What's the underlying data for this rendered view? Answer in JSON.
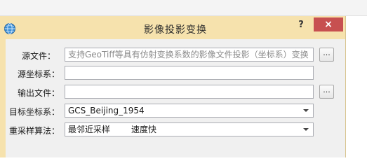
{
  "dialog": {
    "title": "影像投影变换",
    "help_label": "?",
    "close_label": "×"
  },
  "fields": {
    "source_file": {
      "label": "源文件：",
      "value": "",
      "placeholder": "支持GeoTiff等具有仿射变换系数的影像文件投影（坐标系）变换",
      "browse_label": "..."
    },
    "source_crs": {
      "label": "源坐标系：",
      "value": ""
    },
    "output_file": {
      "label": "输出文件：",
      "value": "",
      "browse_label": "..."
    },
    "target_crs": {
      "label": "目标坐标系：",
      "selected": "GCS_Beijing_1954"
    },
    "resampling": {
      "label": "重采样算法：",
      "selected": "最邻近采样",
      "note": "速度快"
    }
  },
  "colors": {
    "title_bar": "#f6e2ad",
    "close_button": "#c75050",
    "client_bg": "#f0f0f0"
  },
  "icons": {
    "app": "globe-icon",
    "browse": "ellipsis",
    "dropdown": "chevron-down-icon"
  }
}
